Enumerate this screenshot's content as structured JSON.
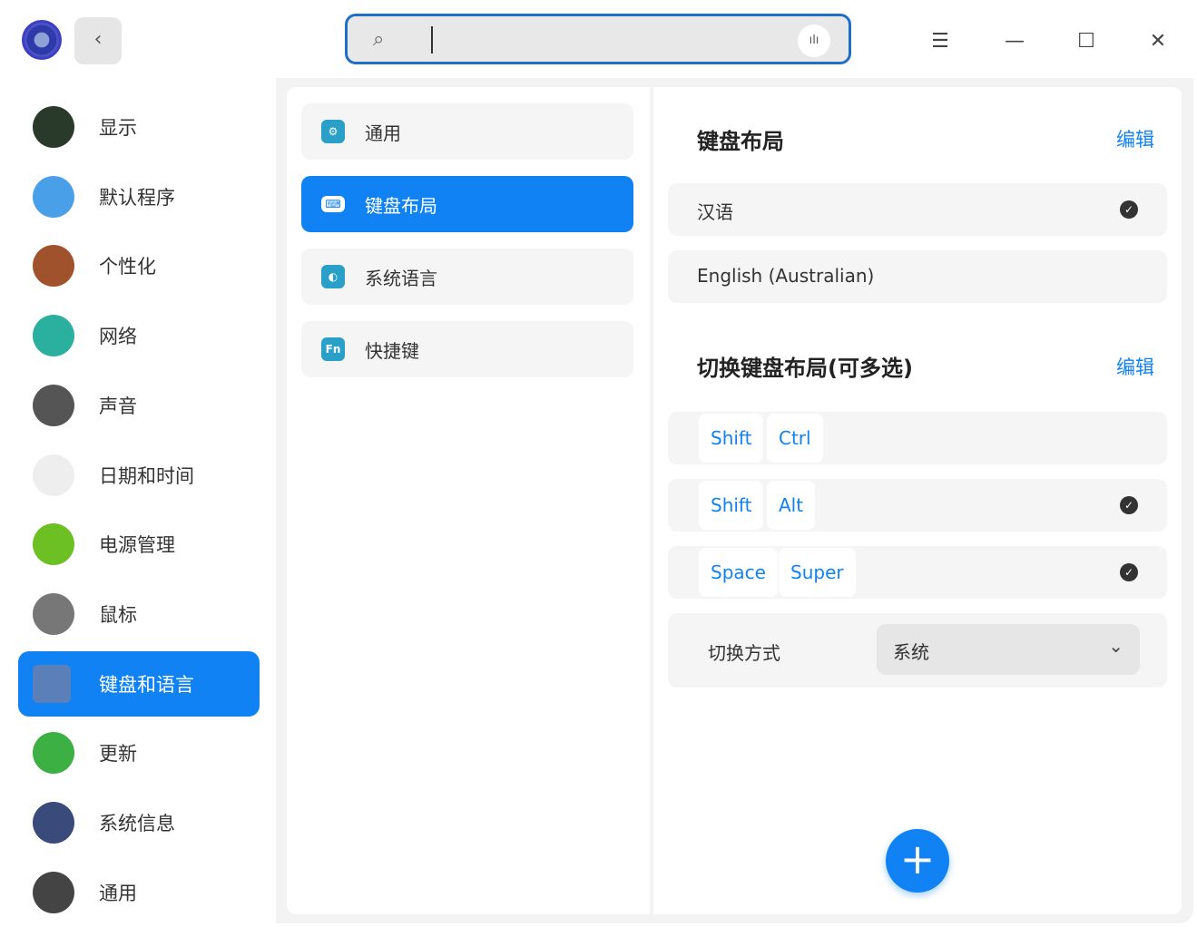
{
  "titlebar": {
    "search_placeholder": "",
    "search_icon": "search-icon",
    "voice_icon": "voice-icon",
    "menu": "☰",
    "minimize": "—",
    "maximize": "☐",
    "close": "✕",
    "back": "‹"
  },
  "sidebar": {
    "items": [
      {
        "label": "显示",
        "icon": "display-icon",
        "color": "#2a3a2a"
      },
      {
        "label": "默认程序",
        "icon": "default-apps-icon",
        "color": "#4aa0e8"
      },
      {
        "label": "个性化",
        "icon": "personalization-icon",
        "color": "#a0522d"
      },
      {
        "label": "网络",
        "icon": "network-icon",
        "color": "#2bb0a0"
      },
      {
        "label": "声音",
        "icon": "sound-icon",
        "color": "#555555"
      },
      {
        "label": "日期和时间",
        "icon": "clock-icon",
        "color": "#eeeeee"
      },
      {
        "label": "电源管理",
        "icon": "power-icon",
        "color": "#6cc024"
      },
      {
        "label": "鼠标",
        "icon": "mouse-icon",
        "color": "#777777"
      },
      {
        "label": "键盘和语言",
        "icon": "keyboard-icon",
        "color": "#5b7fb8"
      },
      {
        "label": "更新",
        "icon": "update-icon",
        "color": "#3cb043"
      },
      {
        "label": "系统信息",
        "icon": "system-info-icon",
        "color": "#3a4a7a"
      },
      {
        "label": "通用",
        "icon": "general-icon",
        "color": "#444444"
      }
    ],
    "active": 8
  },
  "middle": {
    "items": [
      {
        "label": "通用",
        "icon": "gear-icon",
        "glyph": "⚙",
        "color": "#2aa0c8"
      },
      {
        "label": "键盘布局",
        "icon": "keyboard-icon",
        "glyph": "⌨",
        "color": "#ffffff"
      },
      {
        "label": "系统语言",
        "icon": "globe-icon",
        "glyph": "◐",
        "color": "#2aa0c8"
      },
      {
        "label": "快捷键",
        "icon": "fn-key-icon",
        "glyph": "Fn",
        "color": "#2aa0c8"
      }
    ],
    "active": 1
  },
  "right": {
    "layout_title": "键盘布局",
    "edit_label": "编辑",
    "layouts": [
      {
        "name": "汉语",
        "checked": true
      },
      {
        "name": "English (Australian)",
        "checked": false
      }
    ],
    "switch_title": "切换键盘布局(可多选)",
    "switch_edit_label": "编辑",
    "switch_options": [
      {
        "keys": [
          "Shift",
          "Ctrl"
        ],
        "checked": false
      },
      {
        "keys": [
          "Shift",
          "Alt"
        ],
        "checked": true
      },
      {
        "keys": [
          "Space",
          "Super"
        ],
        "checked": true
      }
    ],
    "switch_mode_label": "切换方式",
    "switch_mode_value": "系统",
    "add_label": "+"
  }
}
